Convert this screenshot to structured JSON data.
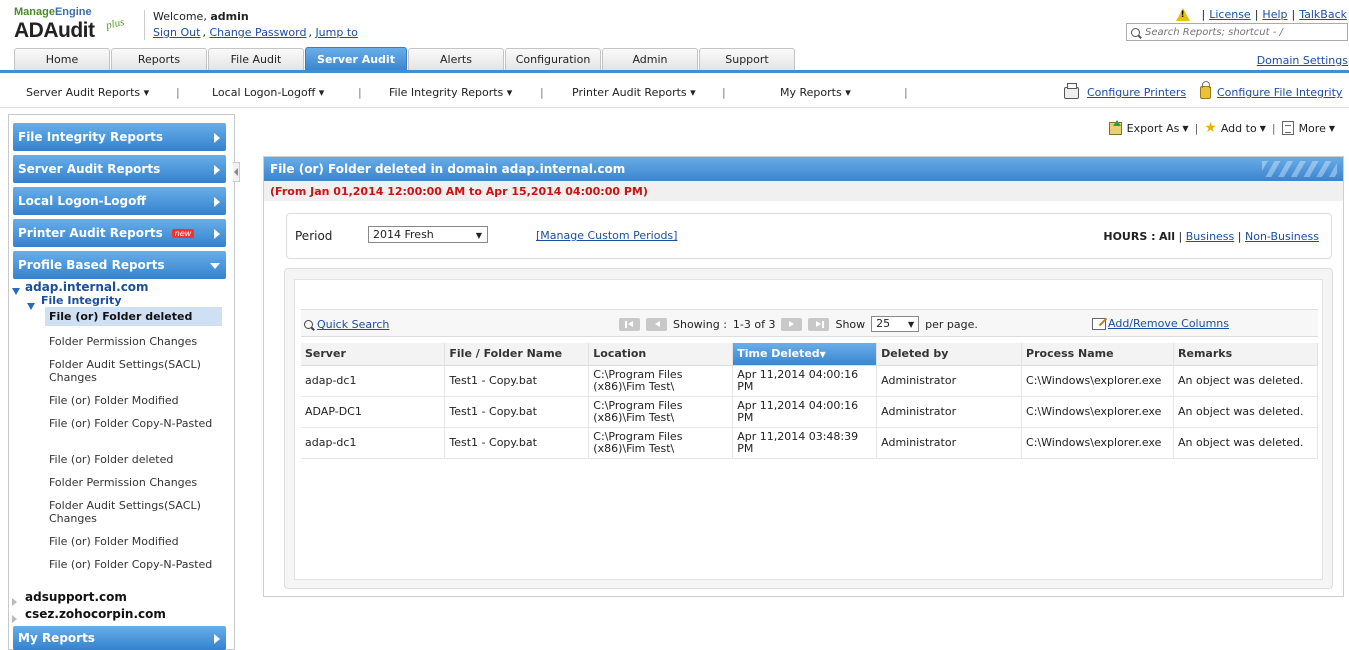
{
  "header": {
    "brand_top_a": "Manage",
    "brand_top_b": "Engine",
    "brand_product": "ADAudit",
    "brand_plus": "plus",
    "welcome_text": "Welcome,",
    "user": "admin",
    "sign_out": "Sign Out",
    "change_password": "Change Password",
    "jump_to": "Jump to",
    "license": "License",
    "help": "Help",
    "talkback": "TalkBack",
    "search_placeholder": "Search Reports; shortcut - /"
  },
  "tabs": [
    {
      "label": "Home"
    },
    {
      "label": "Reports"
    },
    {
      "label": "File Audit"
    },
    {
      "label": "Server Audit"
    },
    {
      "label": "Alerts"
    },
    {
      "label": "Configuration"
    },
    {
      "label": "Admin"
    },
    {
      "label": "Support"
    }
  ],
  "domain_settings": "Domain Settings",
  "subnav": {
    "items": [
      {
        "label": "Server Audit Reports ▾"
      },
      {
        "label": "Local Logon-Logoff ▾"
      },
      {
        "label": "File Integrity Reports ▾"
      },
      {
        "label": "Printer Audit Reports ▾"
      },
      {
        "label": "My Reports ▾"
      }
    ],
    "configure_printers": "Configure Printers",
    "configure_file_integrity": "Configure File Integrity"
  },
  "sidebar": {
    "sections": [
      {
        "label": "File Integrity Reports"
      },
      {
        "label": "Server Audit Reports"
      },
      {
        "label": "Local Logon-Logoff"
      },
      {
        "label": "Printer Audit Reports",
        "badge": "new"
      },
      {
        "label": "Profile Based Reports"
      }
    ],
    "domain1": "adap.internal.com",
    "category": "File Integrity",
    "items": [
      {
        "label": "File (or) Folder deleted"
      },
      {
        "label": "Folder Permission Changes"
      },
      {
        "label": "Folder Audit Settings(SACL) Changes"
      },
      {
        "label": "File (or) Folder Modified"
      },
      {
        "label": "File (or) Folder Copy-N-Pasted"
      },
      {
        "label": "File (or) Folder deleted"
      },
      {
        "label": "Folder Permission Changes"
      },
      {
        "label": "Folder Audit Settings(SACL) Changes"
      },
      {
        "label": "File (or) Folder Modified"
      },
      {
        "label": "File (or) Folder Copy-N-Pasted"
      }
    ],
    "domain2": "adsupport.com",
    "domain3": "csez.zohocorpin.com",
    "my_reports": "My Reports"
  },
  "actions": {
    "export_as": "Export As",
    "add_to": "Add to",
    "more": "More"
  },
  "report": {
    "title": "File (or) Folder deleted in domain adap.internal.com",
    "range": "(From Jan 01,2014 12:00:00 AM to Apr 15,2014 04:00:00 PM)",
    "period_label": "Period",
    "period_value": "2014 Fresh",
    "manage_custom": "[Manage Custom Periods]",
    "hours_label": "HOURS :",
    "hours_all": "All",
    "hours_business": "Business",
    "hours_non_business": "Non-Business",
    "quick_search": "Quick Search",
    "showing_label": "Showing :",
    "showing_range": "1-3 of 3",
    "show_label": "Show",
    "per_page_value": "25",
    "per_page_label": "per page.",
    "add_remove_columns": "Add/Remove Columns",
    "columns": [
      "Server",
      "File / Folder Name",
      "Location",
      "Time Deleted",
      "Deleted by",
      "Process Name",
      "Remarks"
    ],
    "rows": [
      [
        "adap-dc1",
        "Test1 - Copy.bat",
        "C:\\Program Files (x86)\\Fim Test\\",
        "Apr 11,2014 04:00:16 PM",
        "Administrator",
        "C:\\Windows\\explorer.exe",
        "An object was deleted."
      ],
      [
        "ADAP-DC1",
        "Test1 - Copy.bat",
        "C:\\Program Files (x86)\\Fim Test\\",
        "Apr 11,2014 04:00:16 PM",
        "Administrator",
        "C:\\Windows\\explorer.exe",
        "An object was deleted."
      ],
      [
        "adap-dc1",
        "Test1 - Copy.bat",
        "C:\\Program Files (x86)\\Fim Test\\",
        "Apr 11,2014 03:48:39 PM",
        "Administrator",
        "C:\\Windows\\explorer.exe",
        "An object was deleted."
      ]
    ]
  },
  "colors": {
    "accent": "#3a86d0",
    "link": "#1a4fa0",
    "range_text": "#cc1111"
  }
}
